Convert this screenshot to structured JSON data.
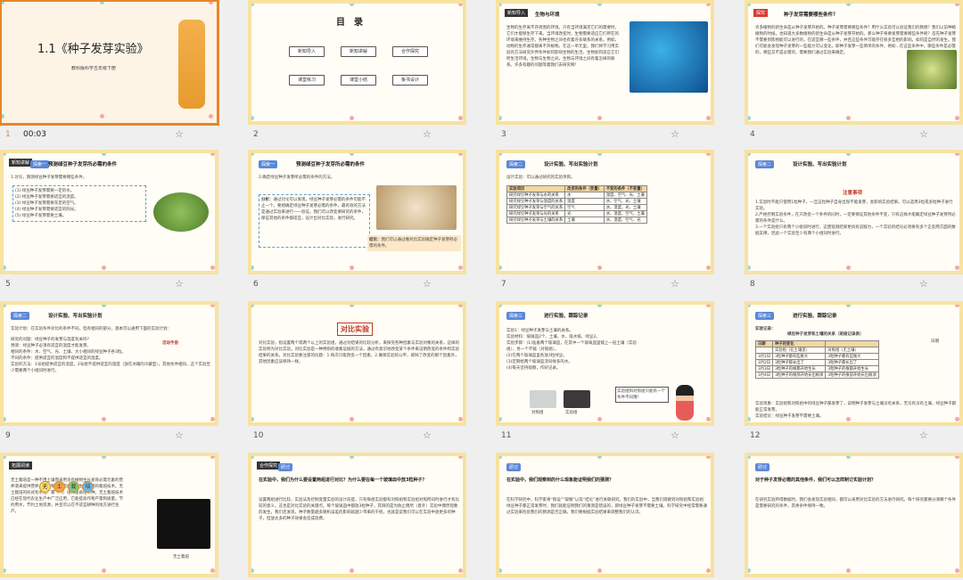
{
  "selected_index": 0,
  "slides": [
    {
      "num": "1",
      "time": "00:03",
      "title": "1.1《种子发芽实验》",
      "subtitle": "教科版科学五年级下册"
    },
    {
      "num": "2",
      "time": "",
      "title": "目　录",
      "items": [
        "新知导入",
        "新知讲解",
        "合作探究",
        "课堂练习",
        "课堂小结",
        "板书设计"
      ]
    },
    {
      "num": "3",
      "time": "",
      "tag": "新知导入",
      "title": "生物与环境",
      "body": "生物的生存离不开周围的环境，只有当环境满足它们的需要时，它们才能够生存下来。当环境改变时，生物需要适应它们所在的环境来维持生存。各种生物之间也有着许多联系的关系。例如，动物的生存通常都离不开植物。在这一单元里，我们将学习用实验的方法研究外界条件如何影响生物的生活，生物如何适应它们所生活环境，生物与生物之间，生物与环境之间有着怎样的联系。许多有趣的问题等着我们去研究啊！"
    },
    {
      "num": "4",
      "time": "",
      "tag": "探究",
      "title": "种子发芽需要哪些条件？",
      "body": "许多植物的新生命是从种子发芽开始的。种子发芽需要哪些条件？用什么实验可以验证我们的猜想？我们以前种植植物的时候，也知道大多数植物的新生命是从种子发芽开始的。那么种子将要发芽需要哪些条件呢？首先种子发芽不需要到陈物能可以进行的，在适宜哪一些条件，并且这些条件可能存在很多互相的影响。如何是自然的发生。我们可能会发现种子发芽的一些能力可以变化，即种子发芽一些简单的条件，例如...在这些条件中，哪些条件是必需的，哪些又不是必需的，需要我们通过实验来确定。"
    },
    {
      "num": "5",
      "time": "",
      "tag": "新知讲解",
      "heading": "探索一",
      "title": "预测绿豆种子发芽所必需的条件",
      "lead": "1.讨论，猜测绿豆种子发芽需要哪些条件。",
      "items": [
        "(1) 绿豆种子发芽需要一定的水。",
        "(2) 绿豆种子发芽需要适宜的温度。",
        "(3) 绿豆种子发芽需要充足的空气。",
        "(4) 绿豆种子发芽需要适宜的阳光。",
        "(5) 绿豆种子发芽需要土壤。"
      ]
    },
    {
      "num": "6",
      "time": "",
      "heading": "探索一",
      "title": "预测绿豆种子发芽所必需的条件",
      "lead": "2.确定绿豆种子发芽所必需的条件的方法。",
      "analysis_label": "分析：",
      "analysis": "通过讨论可以发现，绿豆种子发芽必需的条件可能不止一个。要想确定绿豆种子发芽必需的条件，最有效的方法是通过实验来进行一一验证。我们可以改变要研究的条件，保证其他的条件都适宜，设计出对比实验，进行研究。",
      "conclusion_label": "结论：",
      "conclusion": "我们可以通过做对比实验确定种子发芽所必需的条件。"
    },
    {
      "num": "7",
      "time": "",
      "heading": "探索二",
      "title": "设计实验、写出实验计划",
      "lead": "设计实验：可以通过研究的实验项目。",
      "table": [
        [
          "实验项目",
          "改变的条件（变量）",
          "不变的条件（不变量）"
        ],
        [
          "研究绿豆种子发芽与水的关系",
          "水",
          "温度、空气、光、土壤"
        ],
        [
          "研究绿豆种子发芽与温度的关系",
          "温度",
          "水、空气、光、土壤"
        ],
        [
          "研究绿豆种子发芽与空气的关系",
          "空气",
          "水、温度、光、土壤"
        ],
        [
          "研究绿豆种子发芽与光的关系",
          "光",
          "水、温度、空气、土壤"
        ],
        [
          "研究绿豆种子发芽与土壤的关系",
          "土壤",
          "水、温度、空气、光"
        ]
      ]
    },
    {
      "num": "8",
      "time": "",
      "heading": "探索二",
      "title": "设计实验、写出实验计划",
      "note_title": "注意事项",
      "notes": [
        "1.实验时不能只使用1粒种子，一旦这粒种子自身出现不能发芽，会影响实验结果。可以选用3粒或多粒种子进行实验。",
        "2.严格控制实验条件，在只改变一个条件的同时，一定要保证其他条件不变，只有这样才能确定绿豆种子发芽所必需的条件是什么。",
        "3.一个实验组只有两个小组同时进行，这使观测结果更具有说服力，一个实验的结论必须要有多个正反两方面的数据支撑，因此一个实验至少有两个小组同时进行。"
      ]
    },
    {
      "num": "9",
      "time": "",
      "heading": "探索二",
      "title": "设计实验、写出实验计划",
      "lead": "实验计划：在实验条件对比的条件不同，但有相同的部分，基本可以通用下面的实验计划：",
      "handbook": "活动手册",
      "items": [
        "研究的问题：绿豆种子的发芽与温度有关吗？",
        "预测：绿豆种子必须有适宜的温度才能发芽。",
        "相同的条件：水、空气、光、土壤、大小相同的绿豆种子各3粒。",
        "不同的条件：提供适宜的温度和不提供适宜的温度。",
        "实验的方法：1号组提供适宜的温度，2号组不提供适宜的温度（放在冰箱的冷藏室），其他条件相同，这个实验至少需要两个小组同时进行。"
      ]
    },
    {
      "num": "10",
      "time": "",
      "title": "对比实验",
      "body": "对比实验，指设置两个或两个以上的实验组，通过对结果的比较分析，来探究各种因素与实验对象的关系，这样的实验称为对比实验。对比实验是一种特别的收集证据的方法，通过有意识地改变某个条件来证明改变的条件和实验结果的关系。对比实验要注意的问题：1.每次只能改变一个因素，2.确保实验的公平，即除了改变的那个因素外，其他因素应该保持一样。"
    },
    {
      "num": "11",
      "time": "",
      "heading": "探索三",
      "title": "进行实验、跟踪记录",
      "items": [
        "实验1：绿豆种子发芽与土壤的关系。",
        "实验材料：玻璃皿2个、土壤、水、吸水纸、绿豆2。",
        "实验步骤：(1)准备两个玻璃皿，在其中一个玻璃皿里铺上一层土壤（实验组），另一个不铺（对照组）。",
        "(2)在两个玻璃皿里各放3粒绿豆。",
        "(3)定期给两个玻璃皿浇同样多的水。",
        "(4)每天坚持观察，作好记录。"
      ],
      "photo_labels": [
        "对照组",
        "实验组"
      ],
      "bubble": "实验组和对照组只能有一个条件不同哦！"
    },
    {
      "num": "12",
      "time": "",
      "heading": "探索三",
      "title": "进行实验、跟踪记录",
      "record_label": "实验记录：",
      "record_title": "绿豆种子发芽和土壤的关系（班级记录表）",
      "date_label": "日期",
      "table": [
        [
          "日期",
          "种子的变化",
          ""
        ],
        [
          "",
          "实验组（在土壤里）",
          "对照组（无土壤）"
        ],
        [
          "3月1日",
          "3粒种子都有些胀大",
          "3粒种子都有些胀大"
        ],
        [
          "3月2日",
          "3粒种子都长出了",
          "3粒种子都长出了"
        ],
        [
          "3月3日",
          "3粒种子的根都开始生长",
          "3粒种子的根都开始生长"
        ],
        [
          "3月4日",
          "3粒种子的根部开始长出根须",
          "3粒种子的根部开始长出根须"
        ]
      ],
      "analysis": "实验现象：实验组和对照组中的绿豆种子都发芽了，说明种子发芽与土壤没有关系，无论有没有土壤，绿豆种子都能正常发芽。",
      "conclusion": "实验结论：绿豆种子发芽不需要土壤。"
    },
    {
      "num": "13",
      "time": "",
      "tag": "拓展阅读",
      "badges": [
        "无",
        "土",
        "栽",
        "培"
      ],
      "body": "无土栽培是一种不用土壤而采用含有植物生长发育必需元素的营养液来提供营养，使植物正常完成整个生长周期的栽培技术。无土栽培的形式有水培、雾（气）培和基质培三种。无土栽培技术已经在现代农业生产中广泛应用，它能提高作物产量和质量，节约用水，节约土地资源，并且可以在不适宜耕种的地方进行生产。",
      "photo_label": "无土栽培"
    },
    {
      "num": "14",
      "time": "",
      "tag": "合作探究",
      "heading": "研讨",
      "question": "在实验中，我们为什么要设置两组进行对比？为什么要在每一个玻璃皿中放3粒种子？",
      "body": "设置两组进行比较，实验法及控制变量实验的设计前提，只有每组实验都有对照组和实验组对照所同时进行才有比较的意义，这也是对比实验的关键点。每个玻璃皿中都放3粒种子，其目的是为防止偶然（意外）实验中偶然现象的发生。我们还发现，种子数量越多随机误差的影响就越少带来的干扰，也就是说我们可以在实验中放更多的种子，但放太多的种子效果会造成浪费。"
    },
    {
      "num": "15",
      "time": "",
      "heading": "研讨",
      "question": "在实验中，我们观察到的什么现象能证明我们的猜测？",
      "body": "在科学研究中，科学家将“假设”“观察”以及“结论”进行关联研究。我们的实验中，当我们观察到对照组和实验组绿豆种子都正常发芽时，我们就能证明我们的猜测是错误的，即绿豆种子发芽不需要土壤。科学研究中经常需要通过实验来检验我们的猜测是否正确，我们要根据实验结果来调整我们的认识。"
    },
    {
      "num": "16",
      "time": "",
      "heading": "研讨",
      "question": "对于种子发芽必需的其他条件，我们可以怎样制订实验计划？",
      "body": "在研究实验所得数据时，我们会发现实验相同，都可以采用对比实验的方法进行研究。每个研究都要分清哪个条件是需要研究的条件，其余条件保持一致。"
    }
  ]
}
